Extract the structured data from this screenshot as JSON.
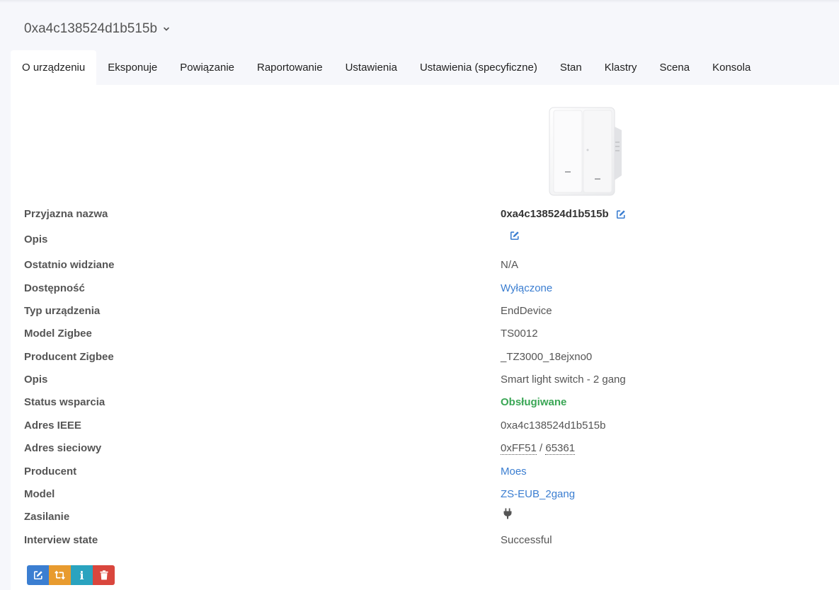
{
  "device_select": {
    "value": "0xa4c138524d1b515b",
    "icon": "chevron-down-icon"
  },
  "tabs": [
    {
      "label": "O urządzeniu",
      "active": true
    },
    {
      "label": "Eksponuje"
    },
    {
      "label": "Powiązanie"
    },
    {
      "label": "Raportowanie"
    },
    {
      "label": "Ustawienia"
    },
    {
      "label": "Ustawienia (specyficzne)"
    },
    {
      "label": "Stan"
    },
    {
      "label": "Klastry"
    },
    {
      "label": "Scena"
    },
    {
      "label": "Konsola"
    }
  ],
  "info": {
    "friendly_name": {
      "label": "Przyjazna nazwa",
      "value": "0xa4c138524d1b515b"
    },
    "description_edit": {
      "label": "Opis"
    },
    "last_seen": {
      "label": "Ostatnio widziane",
      "value": "N/A"
    },
    "availability": {
      "label": "Dostępność",
      "value": "Wyłączone"
    },
    "device_type": {
      "label": "Typ urządzenia",
      "value": "EndDevice"
    },
    "zigbee_model": {
      "label": "Model Zigbee",
      "value": "TS0012"
    },
    "zigbee_manufacturer": {
      "label": "Producent Zigbee",
      "value": "_TZ3000_18ejxno0"
    },
    "description": {
      "label": "Opis",
      "value": "Smart light switch - 2 gang"
    },
    "support_status": {
      "label": "Status wsparcia",
      "value": "Obsługiwane"
    },
    "ieee_address": {
      "label": "Adres IEEE",
      "value": "0xa4c138524d1b515b"
    },
    "network_address": {
      "label": "Adres sieciowy",
      "hex": "0xFF51",
      "separator": " / ",
      "dec": "65361"
    },
    "manufacturer": {
      "label": "Producent",
      "value": "Moes"
    },
    "model": {
      "label": "Model",
      "value": "ZS-EUB_2gang"
    },
    "power": {
      "label": "Zasilanie",
      "icon": "plug-icon"
    },
    "interview_state": {
      "label": "Interview state",
      "value": "Successful"
    }
  },
  "actions": {
    "edit_icon": "edit-icon",
    "rename_icon": "refresh-icon",
    "info_glyph": "i",
    "remove_icon": "trash-icon"
  },
  "colors": {
    "link": "#3b7ed1",
    "supported": "#3aa655",
    "edit_button": "#3b7ed1",
    "rename_button": "#e89b2f",
    "info_button": "#2aa3bf",
    "remove_button": "#d9463d"
  }
}
